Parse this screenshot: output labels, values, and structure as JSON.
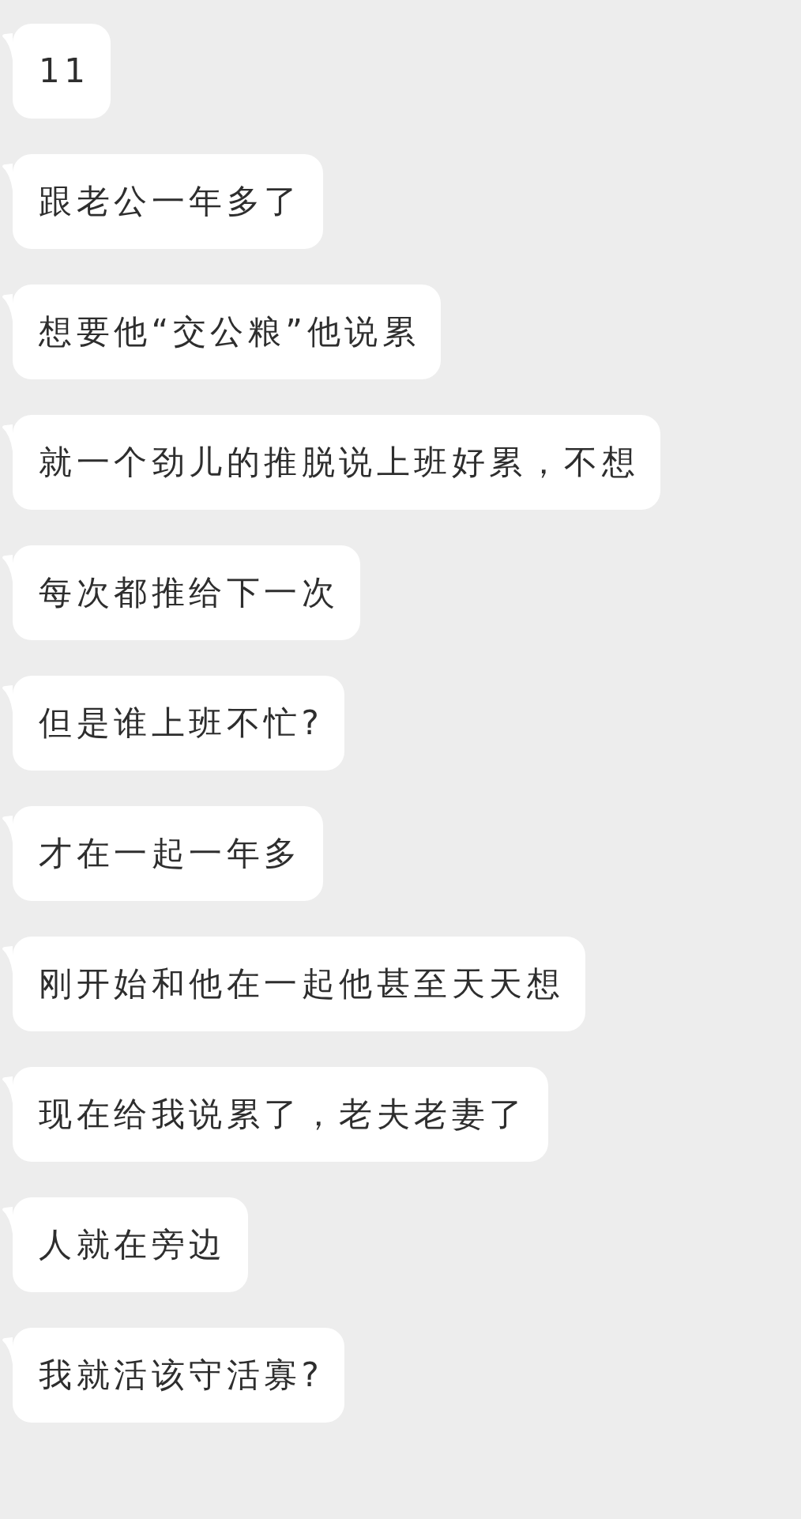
{
  "messages": [
    {
      "text": "11"
    },
    {
      "text": "跟老公一年多了"
    },
    {
      "text": "想要他“交公粮”他说累"
    },
    {
      "text": "就一个劲儿的推脱说上班好累，不想"
    },
    {
      "text": "每次都推给下一次"
    },
    {
      "text": "但是谁上班不忙?"
    },
    {
      "text": "才在一起一年多"
    },
    {
      "text": "刚开始和他在一起他甚至天天想"
    },
    {
      "text": "现在给我说累了，老夫老妻了"
    },
    {
      "text": "人就在旁边"
    },
    {
      "text": "我就活该守活寡?"
    }
  ]
}
